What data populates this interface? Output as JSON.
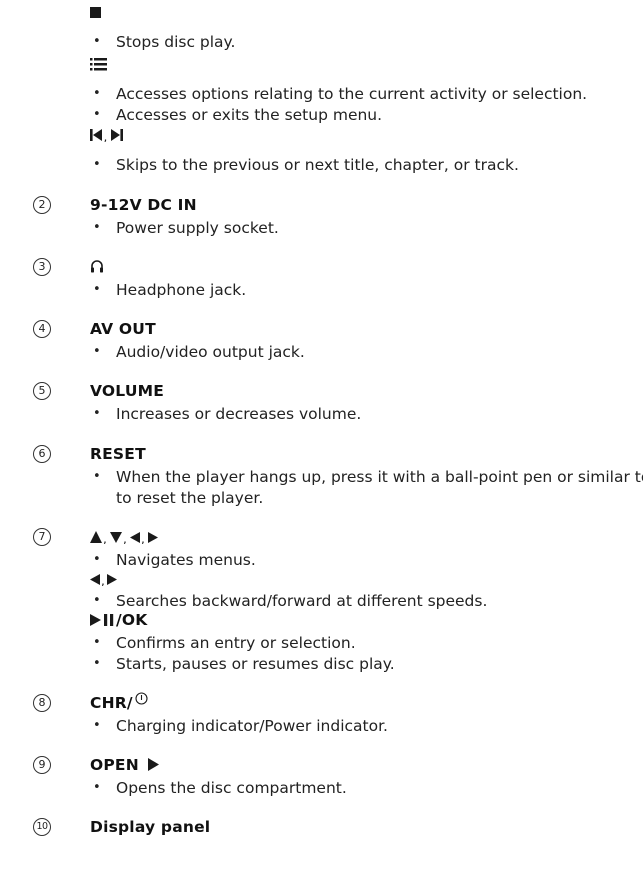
{
  "first_item": {
    "stop_desc": "Stops disc play.",
    "options_desc_1": "Accesses options relating to the current activity or selection.",
    "options_desc_2": "Accesses or exits the setup menu.",
    "skip_desc": "Skips to the previous or next title, chapter, or track."
  },
  "items": [
    {
      "number": "2",
      "label": "9-12V DC IN",
      "bullets": [
        "Power supply socket."
      ]
    },
    {
      "number": "3",
      "bullets": [
        "Headphone jack."
      ]
    },
    {
      "number": "4",
      "label": "AV OUT",
      "bullets": [
        "Audio/video output jack."
      ]
    },
    {
      "number": "5",
      "label": "VOLUME",
      "bullets": [
        "Increases or decreases volume."
      ]
    },
    {
      "number": "6",
      "label": "RESET",
      "bullets": [
        "When the player hangs up, press it with a ball-point pen or similar tool",
        "to reset the player."
      ]
    },
    {
      "number": "7",
      "nav_desc": "Navigates menus.",
      "search_desc": "Searches backward/forward at different speeds.",
      "ok_label": "/OK",
      "ok_desc_1": "Confirms an entry or selection.",
      "ok_desc_2": "Starts, pauses or resumes disc play."
    },
    {
      "number": "8",
      "label": "CHR/ ",
      "bullets": [
        "Charging indicator/Power indicator."
      ]
    },
    {
      "number": "9",
      "label": "OPEN ",
      "bullets": [
        "Opens the disc compartment."
      ]
    },
    {
      "number": "10",
      "label": "Display panel"
    }
  ],
  "icons": {
    "stop": "stop-square-icon",
    "options": "options-list-icon",
    "skip": "previous-next-icon",
    "headphone": "headphone-icon",
    "arrows": "arrow-keys-icon",
    "play_pause": "play-pause-icon",
    "power": "power-icon",
    "play": "play-icon"
  }
}
